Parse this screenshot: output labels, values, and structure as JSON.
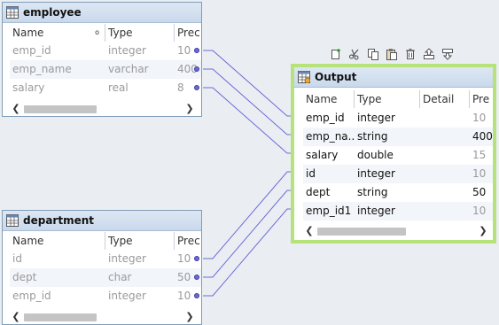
{
  "colors": {
    "link": "#6b6bd6",
    "output_border": "#b6e27a",
    "title_bg": "#c9d9ec"
  },
  "employee": {
    "title": "employee",
    "headers": [
      "Name",
      "Type",
      "Prec"
    ],
    "sort_icon": "column-options-icon",
    "rows": [
      {
        "name": "emp_id",
        "type": "integer",
        "prec": "10"
      },
      {
        "name": "emp_name",
        "type": "varchar",
        "prec": "400"
      },
      {
        "name": "salary",
        "type": "real",
        "prec": "8"
      }
    ]
  },
  "department": {
    "title": "department",
    "headers": [
      "Name",
      "Type",
      "Prec"
    ],
    "rows": [
      {
        "name": "id",
        "type": "integer",
        "prec": "10"
      },
      {
        "name": "dept",
        "type": "char",
        "prec": "50"
      },
      {
        "name": "emp_id",
        "type": "integer",
        "prec": "10"
      }
    ]
  },
  "output": {
    "title": "Output",
    "headers": [
      "Name",
      "Type",
      "Detail",
      "Pre"
    ],
    "rows": [
      {
        "name": "emp_id",
        "type": "integer",
        "detail": "",
        "prec": "10"
      },
      {
        "name": "emp_na...",
        "type": "string",
        "detail": "",
        "prec": "400"
      },
      {
        "name": "salary",
        "type": "double",
        "detail": "",
        "prec": "15"
      },
      {
        "name": "id",
        "type": "integer",
        "detail": "",
        "prec": "10"
      },
      {
        "name": "dept",
        "type": "string",
        "detail": "",
        "prec": "50"
      },
      {
        "name": "emp_id1",
        "type": "integer",
        "detail": "",
        "prec": "10"
      }
    ]
  },
  "toolbar": {
    "icons": [
      "new-port-icon",
      "cut-icon",
      "copy-icon",
      "paste-icon",
      "delete-icon",
      "move-up-icon",
      "move-down-icon"
    ]
  }
}
